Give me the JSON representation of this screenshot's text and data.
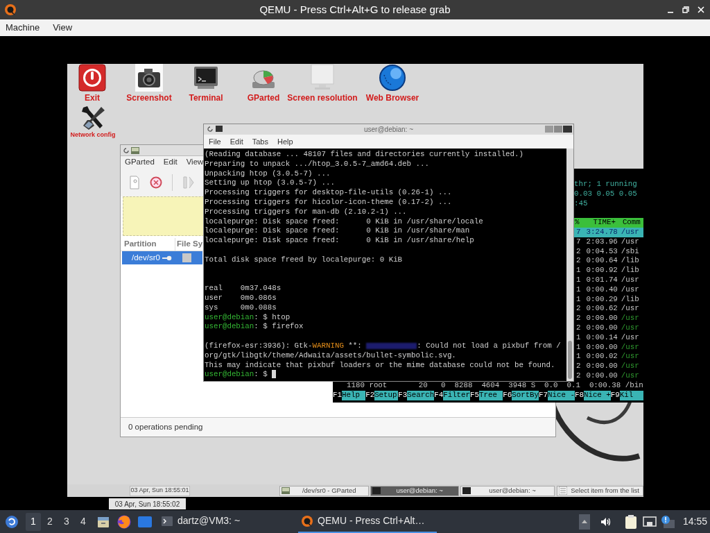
{
  "window": {
    "title": "QEMU - Press Ctrl+Alt+G to release grab"
  },
  "menu": [
    "Machine",
    "View"
  ],
  "desktop_icons": [
    {
      "label": "Exit",
      "kind": "exit"
    },
    {
      "label": "Screenshot",
      "kind": "camera"
    },
    {
      "label": "Terminal",
      "kind": "terminal"
    },
    {
      "label": "GParted",
      "kind": "disk"
    },
    {
      "label": "Screen resolution",
      "kind": "monitor"
    },
    {
      "label": "Web Browser",
      "kind": "globe"
    },
    {
      "label": "Network config",
      "kind": "tools"
    }
  ],
  "gparted": {
    "menu": [
      "GParted",
      "Edit",
      "View"
    ],
    "columns": [
      "Partition",
      "File Sy"
    ],
    "rows": [
      {
        "partition": "/dev/sr0",
        "selected": true
      }
    ],
    "status": "0 operations pending"
  },
  "htop": {
    "header_lines": [
      "thr; 1 running",
      "0.03 0.05 0.05",
      ":45"
    ],
    "columns": [
      "%",
      "TIME+",
      "Comm"
    ],
    "rows": [
      {
        "cpu": "7",
        "time": "3:24.78",
        "command": "/usr",
        "kind": "process",
        "selected": true
      },
      {
        "cpu": "7",
        "time": "2:03.96",
        "command": "/usr",
        "kind": "process",
        "selected": false
      },
      {
        "cpu": "2",
        "time": "0:04.53",
        "command": "/sbi",
        "kind": "process",
        "selected": false
      },
      {
        "cpu": "2",
        "time": "0:00.64",
        "command": "/lib",
        "kind": "process",
        "selected": false
      },
      {
        "cpu": "1",
        "time": "0:00.92",
        "command": "/lib",
        "kind": "process",
        "selected": false
      },
      {
        "cpu": "1",
        "time": "0:01.74",
        "command": "/usr",
        "kind": "process",
        "selected": false
      },
      {
        "cpu": "1",
        "time": "0:00.40",
        "command": "/usr",
        "kind": "process",
        "selected": false
      },
      {
        "cpu": "1",
        "time": "0:00.29",
        "command": "/lib",
        "kind": "process",
        "selected": false
      },
      {
        "cpu": "2",
        "time": "0:00.62",
        "command": "/usr",
        "kind": "process",
        "selected": false
      },
      {
        "cpu": "2",
        "time": "0:00.00",
        "command": "/usr",
        "kind": "thread",
        "selected": false
      },
      {
        "cpu": "2",
        "time": "0:00.00",
        "command": "/usr",
        "kind": "thread",
        "selected": false
      },
      {
        "cpu": "1",
        "time": "0:00.14",
        "command": "/usr",
        "kind": "process",
        "selected": false
      },
      {
        "cpu": "1",
        "time": "0:00.00",
        "command": "/usr",
        "kind": "thread",
        "selected": false
      },
      {
        "cpu": "1",
        "time": "0:00.02",
        "command": "/usr",
        "kind": "thread",
        "selected": false
      },
      {
        "cpu": "2",
        "time": "0:00.00",
        "command": "/usr",
        "kind": "thread",
        "selected": false
      },
      {
        "cpu": "2",
        "time": "0:00.00",
        "command": "/usr",
        "kind": "thread",
        "selected": false
      }
    ],
    "bottom_row": "1180 root       20   0  8288  4604  3948 S  0.0  0.1  0:00.38 /bin",
    "function_keys": [
      {
        "key": "F1",
        "label": "Help"
      },
      {
        "key": "F2",
        "label": "Setup"
      },
      {
        "key": "F3",
        "label": "Search"
      },
      {
        "key": "F4",
        "label": "Filter"
      },
      {
        "key": "F5",
        "label": "Tree"
      },
      {
        "key": "F6",
        "label": "SortBy"
      },
      {
        "key": "F7",
        "label": "Nice -"
      },
      {
        "key": "F8",
        "label": "Nice +"
      },
      {
        "key": "F9",
        "label": "Kil"
      }
    ]
  },
  "terminal": {
    "title": "user@debian: ~",
    "menu": [
      "File",
      "Edit",
      "Tabs",
      "Help"
    ],
    "lines": [
      {
        "kind": "output",
        "segments": [
          {
            "kind": "plain",
            "text": "(Reading database ... 48107 files and directories currently installed.)"
          }
        ]
      },
      {
        "kind": "output",
        "segments": [
          {
            "kind": "plain",
            "text": "Preparing to unpack .../htop_3.0.5-7_amd64.deb ..."
          }
        ]
      },
      {
        "kind": "output",
        "segments": [
          {
            "kind": "plain",
            "text": "Unpacking htop (3.0.5-7) ..."
          }
        ]
      },
      {
        "kind": "output",
        "segments": [
          {
            "kind": "plain",
            "text": "Setting up htop (3.0.5-7) ..."
          }
        ]
      },
      {
        "kind": "output",
        "segments": [
          {
            "kind": "plain",
            "text": "Processing triggers for desktop-file-utils (0.26-1) ..."
          }
        ]
      },
      {
        "kind": "output",
        "segments": [
          {
            "kind": "plain",
            "text": "Processing triggers for hicolor-icon-theme (0.17-2) ..."
          }
        ]
      },
      {
        "kind": "output",
        "segments": [
          {
            "kind": "plain",
            "text": "Processing triggers for man-db (2.10.2-1) ..."
          }
        ]
      },
      {
        "kind": "output",
        "segments": [
          {
            "kind": "plain",
            "text": "localepurge: Disk space freed:      0 KiB in /usr/share/locale"
          }
        ]
      },
      {
        "kind": "output",
        "segments": [
          {
            "kind": "plain",
            "text": "localepurge: Disk space freed:      0 KiB in /usr/share/man"
          }
        ]
      },
      {
        "kind": "output",
        "segments": [
          {
            "kind": "plain",
            "text": "localepurge: Disk space freed:      0 KiB in /usr/share/help"
          }
        ]
      },
      {
        "kind": "blank"
      },
      {
        "kind": "output",
        "segments": [
          {
            "kind": "plain",
            "text": "Total disk space freed by localepurge: 0 KiB"
          }
        ]
      },
      {
        "kind": "blank"
      },
      {
        "kind": "blank"
      },
      {
        "kind": "output",
        "segments": [
          {
            "kind": "plain",
            "text": "real    0m37.048s"
          }
        ]
      },
      {
        "kind": "output",
        "segments": [
          {
            "kind": "plain",
            "text": "user    0m0.086s"
          }
        ]
      },
      {
        "kind": "output",
        "segments": [
          {
            "kind": "plain",
            "text": "sys     0m0.088s"
          }
        ]
      },
      {
        "kind": "output",
        "segments": [
          {
            "kind": "prompt",
            "text": "user@debian"
          },
          {
            "kind": "plain",
            "text": ": $ htop"
          }
        ]
      },
      {
        "kind": "output",
        "segments": [
          {
            "kind": "prompt",
            "text": "user@debian"
          },
          {
            "kind": "plain",
            "text": ": $ firefox"
          }
        ]
      },
      {
        "kind": "blank"
      },
      {
        "kind": "output",
        "segments": [
          {
            "kind": "plain",
            "text": "(firefox-esr:3936): Gtk-"
          },
          {
            "kind": "warning",
            "text": "WARNING"
          },
          {
            "kind": "plain",
            "text": " **: "
          },
          {
            "kind": "blurred"
          },
          {
            "kind": "plain",
            "text": ": Could not load a pixbuf from /"
          }
        ]
      },
      {
        "kind": "output",
        "segments": [
          {
            "kind": "plain",
            "text": "org/gtk/libgtk/theme/Adwaita/assets/bullet-symbolic.svg."
          }
        ]
      },
      {
        "kind": "output",
        "segments": [
          {
            "kind": "plain",
            "text": "This may indicate that pixbuf loaders or the mime database could not be found."
          }
        ]
      },
      {
        "kind": "output",
        "cursor": true,
        "segments": [
          {
            "kind": "prompt",
            "text": "user@debian"
          },
          {
            "kind": "plain",
            "text": ": $ "
          }
        ]
      }
    ]
  },
  "guest_panel": {
    "clock": "03 Apr, Sun 18:55:01",
    "tasks": [
      {
        "label": "/dev/sr0 - GParted",
        "kind": "gparted",
        "selected": false
      },
      {
        "label": "user@debian: ~",
        "kind": "terminal",
        "selected": true
      },
      {
        "label": "user@debian: ~",
        "kind": "terminal",
        "selected": false
      },
      {
        "label": "Select item from the list",
        "kind": "list",
        "selected": false
      }
    ]
  },
  "tooltip": "03 Apr, Sun 18:55:02",
  "taskbar": {
    "workspaces": [
      {
        "label": "1",
        "selected": true
      },
      {
        "label": "2",
        "selected": false
      },
      {
        "label": "3",
        "selected": false
      },
      {
        "label": "4",
        "selected": false
      }
    ],
    "tasks": [
      {
        "label": "dartz@VM3: ~",
        "kind": "terminal",
        "selected": false
      },
      {
        "label": "QEMU - Press Ctrl+Alt…",
        "kind": "qemu",
        "selected": true
      }
    ],
    "clock": "14:55"
  }
}
